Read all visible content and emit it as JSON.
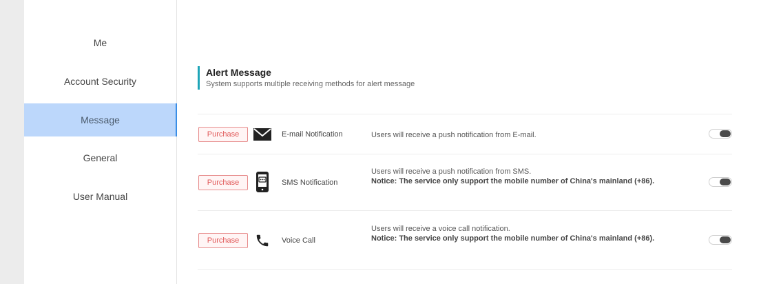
{
  "sidebar": {
    "items": [
      {
        "label": "Me"
      },
      {
        "label": "Account Security"
      },
      {
        "label": "Message",
        "active": true
      },
      {
        "label": "General"
      },
      {
        "label": "User Manual"
      }
    ]
  },
  "section": {
    "title": "Alert Message",
    "subtitle": "System supports multiple receiving methods for alert message"
  },
  "services": [
    {
      "purchase_label": "Purchase",
      "icon": "envelope-icon",
      "name": "E-mail Notification",
      "description": "Users will receive a push notification from E-mail.",
      "notice": "",
      "enabled": false
    },
    {
      "purchase_label": "Purchase",
      "icon": "sms-phone-icon",
      "name": "SMS Notification",
      "description": "Users will receive a push notification from SMS.",
      "notice": "Notice: The service only support the mobile number of China's mainland (+86).",
      "enabled": false
    },
    {
      "purchase_label": "Purchase",
      "icon": "phone-handset-icon",
      "name": "Voice Call",
      "description": "Users will receive a voice call notification.",
      "notice": "Notice: The service only support the mobile number of China's mainland (+86).",
      "enabled": false
    }
  ],
  "colors": {
    "accent_bar": "#1ea5b8",
    "active_nav_bg": "#bcd7fb",
    "purchase_text": "#e05656"
  }
}
